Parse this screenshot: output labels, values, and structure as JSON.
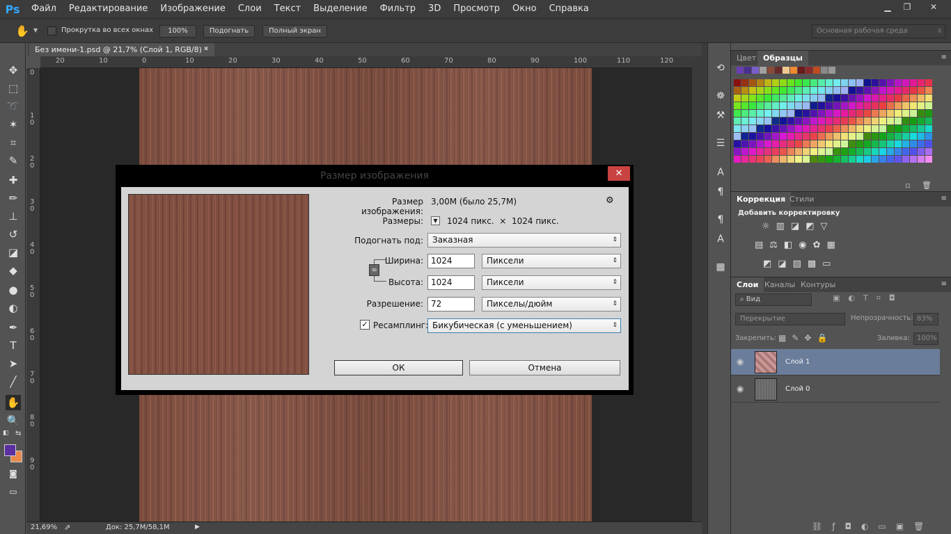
{
  "app": {
    "logo": "Ps"
  },
  "menu": [
    "Файл",
    "Редактирование",
    "Изображение",
    "Слои",
    "Текст",
    "Выделение",
    "Фильтр",
    "3D",
    "Просмотр",
    "Окно",
    "Справка"
  ],
  "window_controls": {
    "minimize": "▁",
    "restore": "❐",
    "close": "✕"
  },
  "options": {
    "scroll_all_label": "Прокрутка во всех окнах",
    "zoom_100": "100%",
    "fit_screen": "Подогнать",
    "full_screen": "Полный экран",
    "workspace": "Основная рабочая среда"
  },
  "document": {
    "tab_title": "Без имени-1.psd @ 21,7% (Слой 1, RGB/8) *",
    "tab_close": "✕",
    "zoom": "21,69%",
    "doc_info": "Док: 25,7М/58,1М"
  },
  "rulers": {
    "h_ticks": [
      "20",
      "10",
      "0",
      "10",
      "20",
      "30",
      "40",
      "50",
      "60",
      "70",
      "80",
      "90",
      "100",
      "110",
      "120"
    ],
    "v_ticks": [
      "0",
      "1\n0",
      "2\n0",
      "3\n0",
      "4\n0",
      "5\n0",
      "6\n0",
      "7\n0",
      "8\n0",
      "9\n0"
    ]
  },
  "tools": [
    "move-icon",
    "marquee-icon",
    "lasso-icon",
    "magic-wand-icon",
    "crop-icon",
    "eyedropper-icon",
    "healing-icon",
    "brush-icon",
    "stamp-icon",
    "history-brush-icon",
    "eraser-icon",
    "bucket-icon",
    "blur-icon",
    "dodge-icon",
    "pen-icon",
    "type-icon",
    "path-select-icon",
    "line-icon",
    "hand-icon",
    "zoom-icon"
  ],
  "colors": {
    "foreground": "#5b2fa0",
    "background": "#e9894a",
    "accent_select": "#6a7d9a"
  },
  "panels": {
    "swatch_tabs": [
      "Цвет",
      "Образцы"
    ],
    "adjust_tabs": [
      "Коррекция",
      "Стили"
    ],
    "adjust_heading": "Добавить корректировку",
    "layer_tabs": [
      "Слои",
      "Каналы",
      "Контуры"
    ],
    "filter_kind": "Вид",
    "blend_mode": "Перекрытие",
    "opacity_label": "Непрозрачность:",
    "opacity_value": "83%",
    "lock_label": "Закрепить:",
    "fill_label": "Заливка:",
    "fill_value": "100%",
    "layers": [
      {
        "name": "Слой 1",
        "selected": true
      },
      {
        "name": "Слой 0",
        "selected": false
      }
    ]
  },
  "dialog": {
    "title": "Размер изображения",
    "close": "✕",
    "image_size_label": "Размер изображения:",
    "image_size_value": "3,00М (было 25,7М)",
    "gear": "⚙",
    "dimensions_label": "Размеры:",
    "dimensions_value": "1024 пикс.  ×  1024 пикс.",
    "fit_label": "Подогнать под:",
    "fit_value": "Заказная",
    "width_label": "Ширина:",
    "width_value": "1024",
    "width_unit": "Пиксели",
    "height_label": "Высота:",
    "height_value": "1024",
    "height_unit": "Пиксели",
    "resolution_label": "Разрешение:",
    "resolution_value": "72",
    "resolution_unit": "Пикселы/дюйм",
    "resample_label": "Ресамплинг:",
    "resample_checked": "✓",
    "resample_value": "Бикубическая (с уменьшением)",
    "ok": "ОК",
    "cancel": "Отмена"
  }
}
